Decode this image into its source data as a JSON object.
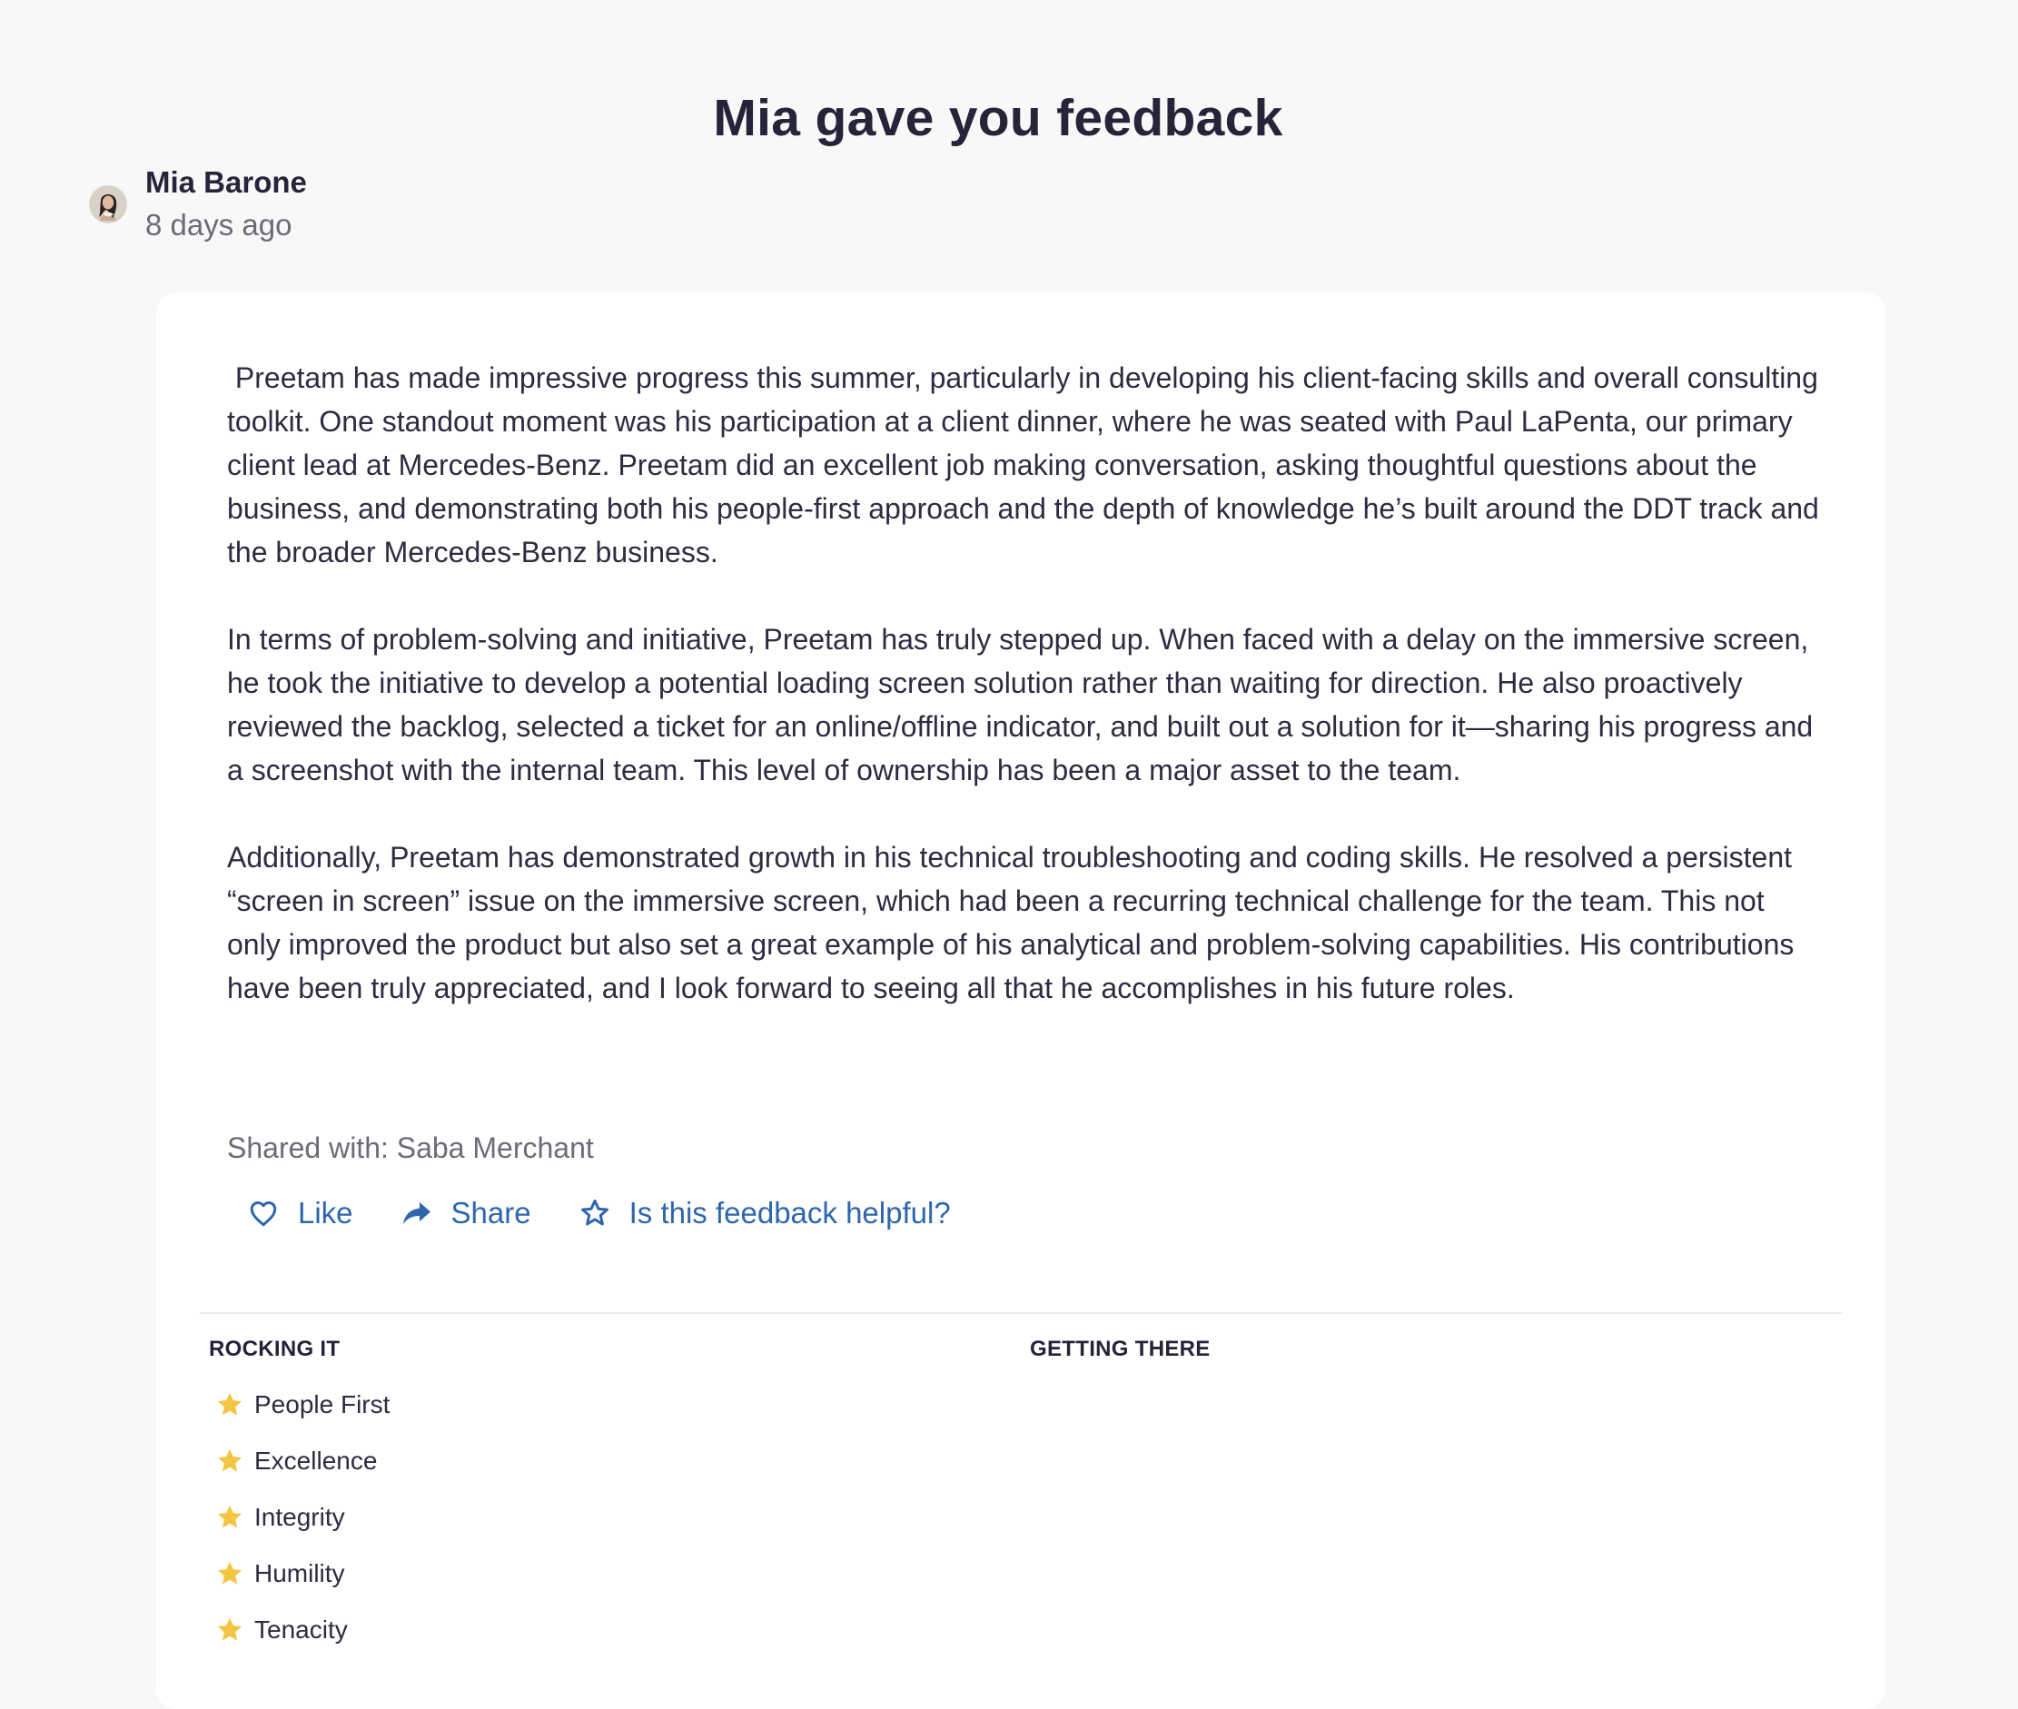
{
  "page": {
    "title": "Mia gave you feedback"
  },
  "author": {
    "name": "Mia Barone",
    "time": "8 days ago"
  },
  "feedback": {
    "paragraphs": [
      " Preetam has made impressive progress this summer, particularly in developing his client-facing skills and overall consulting toolkit. One standout moment was his participation at a client dinner, where he was seated with Paul LaPenta, our primary client lead at Mercedes-Benz. Preetam did an excellent job making conversation, asking thoughtful questions about the business, and demonstrating both his people-first approach and the depth of knowledge he’s built around the DDT track and the broader Mercedes-Benz business.",
      "In terms of problem-solving and initiative, Preetam has truly stepped up. When faced with a delay on the immersive screen, he took the initiative to develop a potential loading screen solution rather than waiting for direction. He also proactively reviewed the backlog, selected a ticket for an online/offline indicator, and built out a solution for it—sharing his progress and a screenshot with the internal team. This level of ownership has been a major asset to the team.",
      "Additionally, Preetam has demonstrated growth in his technical troubleshooting and coding skills. He resolved a persistent “screen in screen” issue on the immersive screen, which had been a recurring technical challenge for the team. This not only improved the product but also set a great example of his analytical and problem-solving capabilities. His contributions have been truly appreciated, and I look forward to seeing all that he accomplishes in his future roles."
    ],
    "shared_with": "Shared with: Saba Merchant"
  },
  "actions": {
    "like": "Like",
    "share": "Share",
    "helpful": "Is this feedback helpful?"
  },
  "sections": {
    "rocking_it": {
      "title": "ROCKING IT",
      "items": [
        "People First",
        "Excellence",
        "Integrity",
        "Humility",
        "Tenacity"
      ]
    },
    "getting_there": {
      "title": "GETTING THERE"
    }
  },
  "colors": {
    "background": "#f8f8f9",
    "card": "#ffffff",
    "text": "#2d2c41",
    "muted": "#6c6b77",
    "action": "#2e66ad",
    "star": "#f4c542"
  },
  "icons": {
    "like": "heart-icon",
    "share": "share-arrow-icon",
    "helpful": "star-outline-icon",
    "value": "star-filled-icon"
  }
}
